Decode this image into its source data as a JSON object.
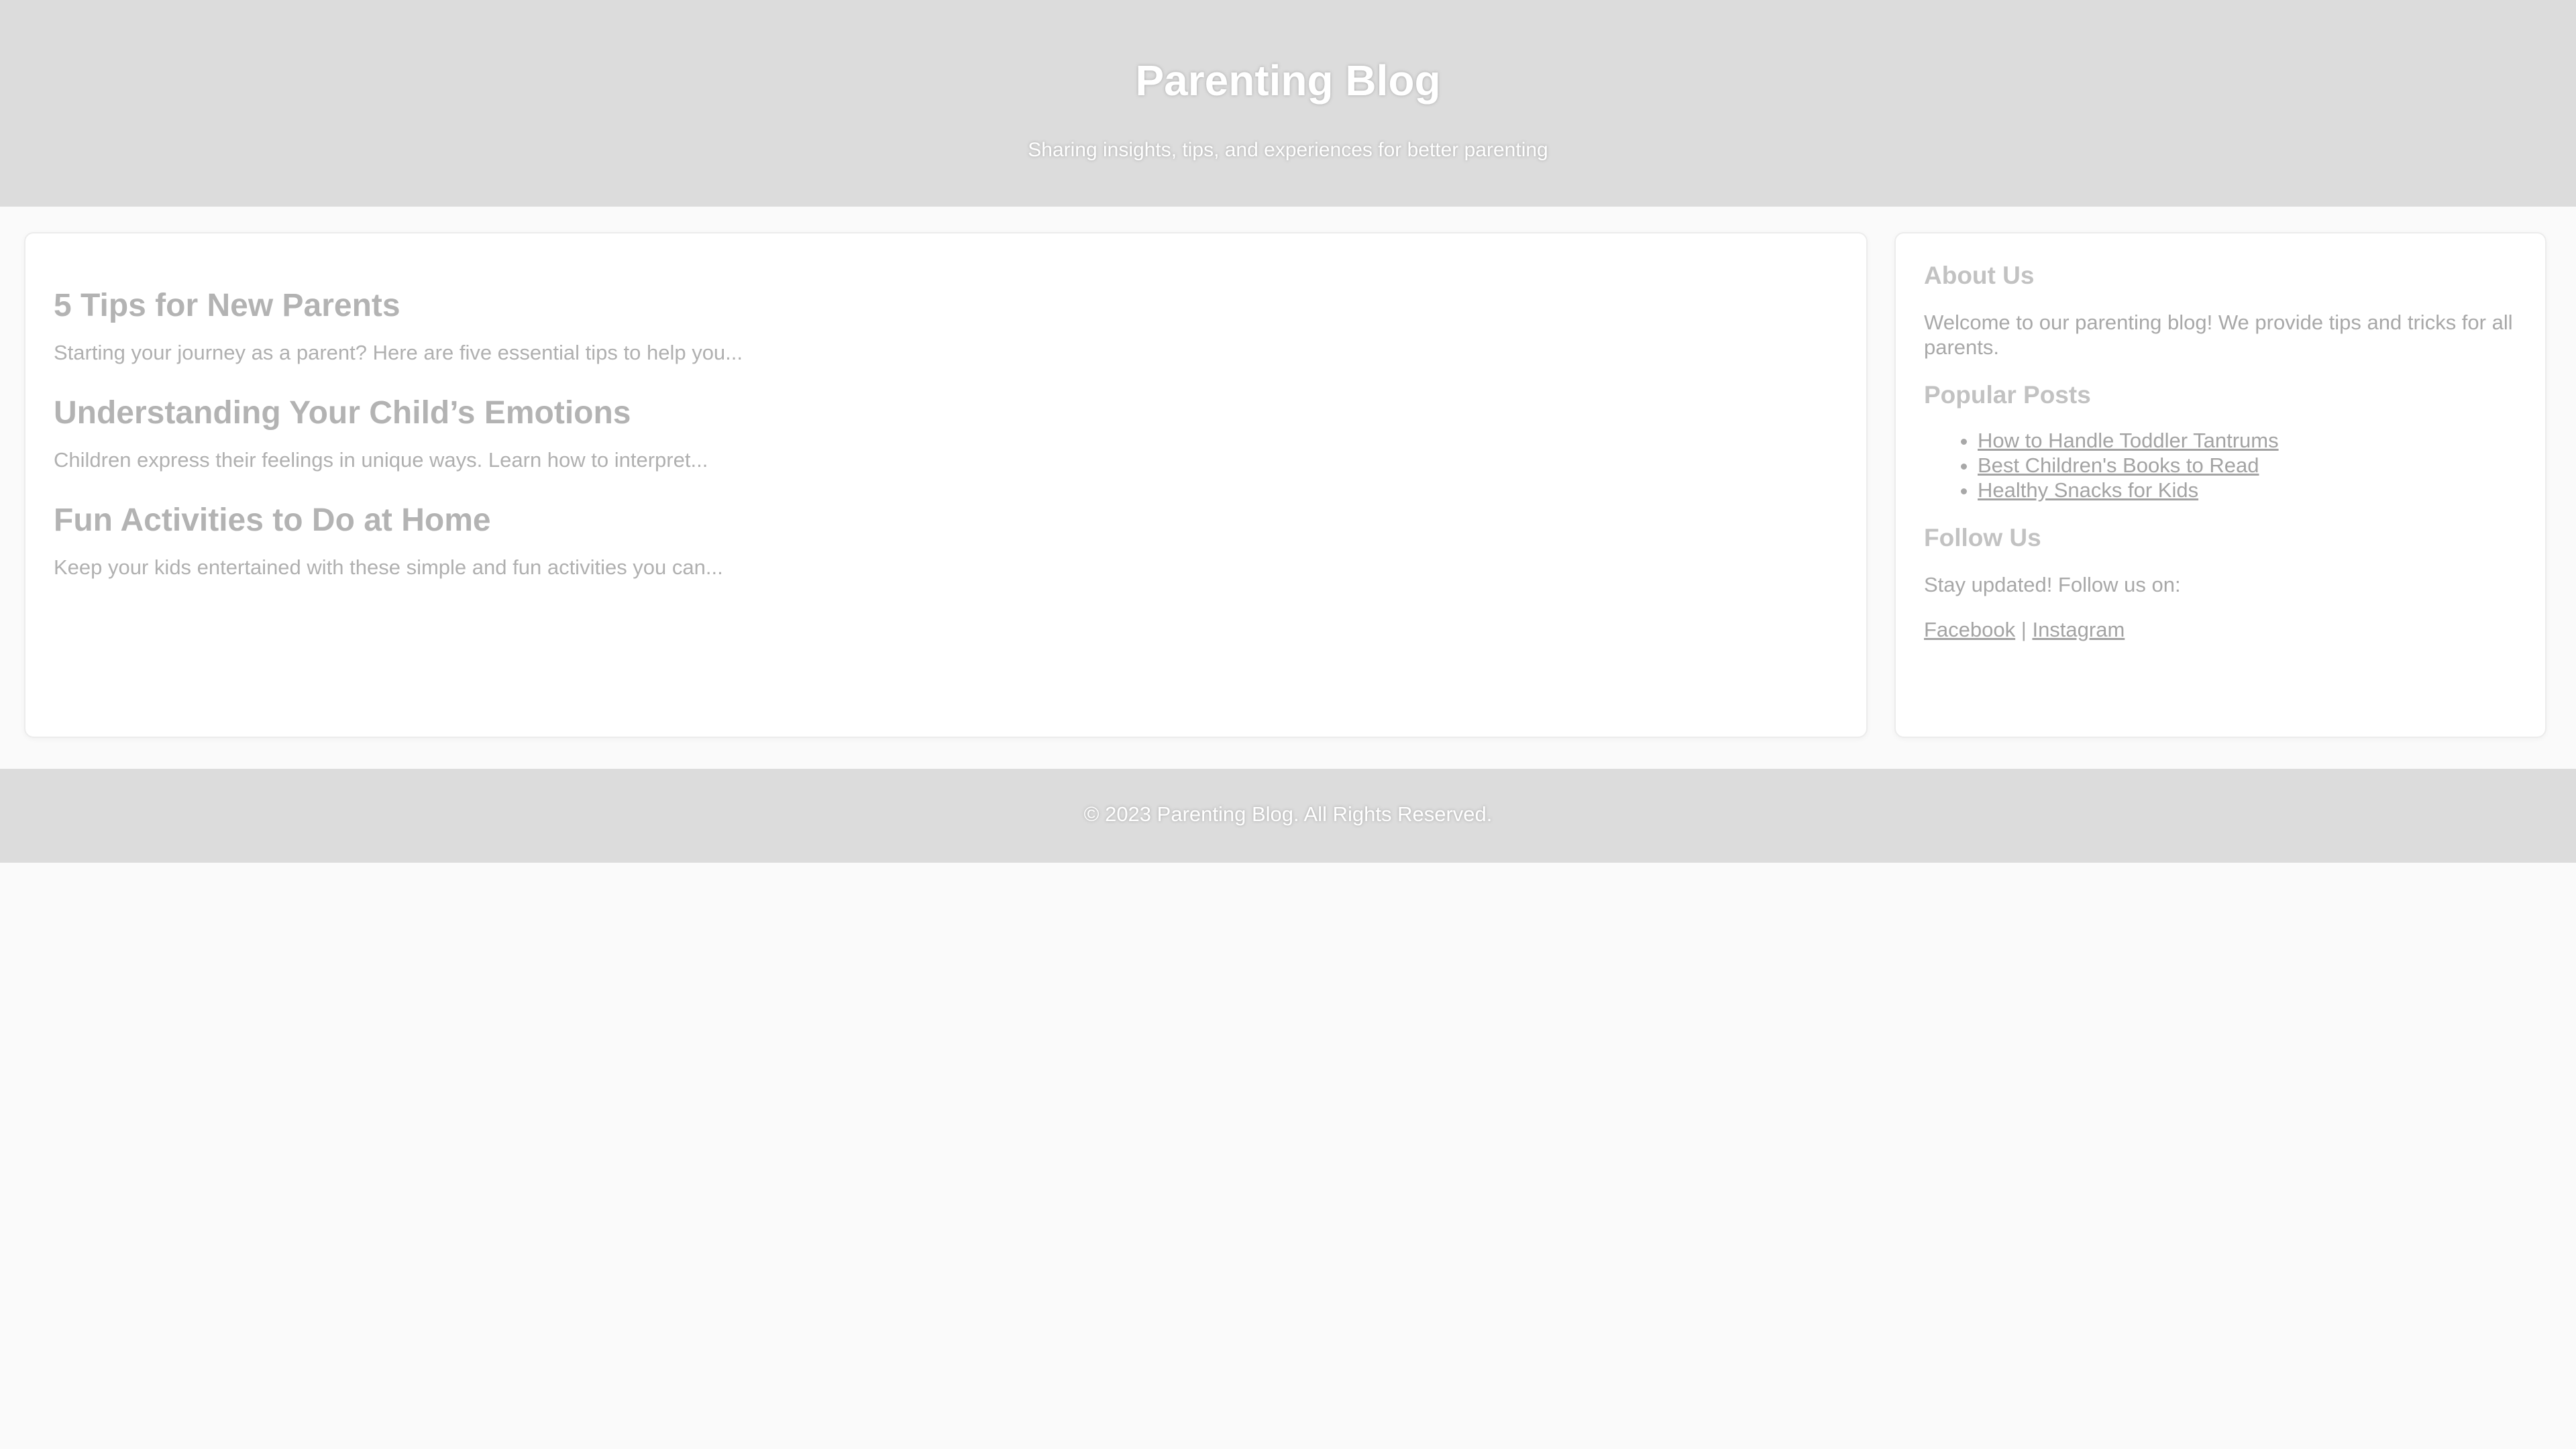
{
  "header": {
    "title": "Parenting Blog",
    "tagline": "Sharing insights, tips, and experiences for better parenting"
  },
  "posts": [
    {
      "title": "5 Tips for New Parents",
      "excerpt": "Starting your journey as a parent? Here are five essential tips to help you..."
    },
    {
      "title": "Understanding Your Child’s Emotions",
      "excerpt": "Children express their feelings in unique ways. Learn how to interpret..."
    },
    {
      "title": "Fun Activities to Do at Home",
      "excerpt": "Keep your kids entertained with these simple and fun activities you can..."
    }
  ],
  "sidebar": {
    "about": {
      "heading": "About Us",
      "text": "Welcome to our parenting blog! We provide tips and tricks for all parents."
    },
    "popular": {
      "heading": "Popular Posts",
      "items": [
        "How to Handle Toddler Tantrums",
        "Best Children's Books to Read",
        "Healthy Snacks for Kids"
      ]
    },
    "follow": {
      "heading": "Follow Us",
      "text": "Stay updated! Follow us on:",
      "links": [
        "Facebook",
        "Instagram"
      ],
      "separator": "|"
    }
  },
  "footer": {
    "copyright": "© 2023 Parenting Blog. All Rights Reserved."
  },
  "colors": {
    "header_bg": "#dcdcdc",
    "page_bg": "#fafafa",
    "card_bg": "#ffffff"
  }
}
